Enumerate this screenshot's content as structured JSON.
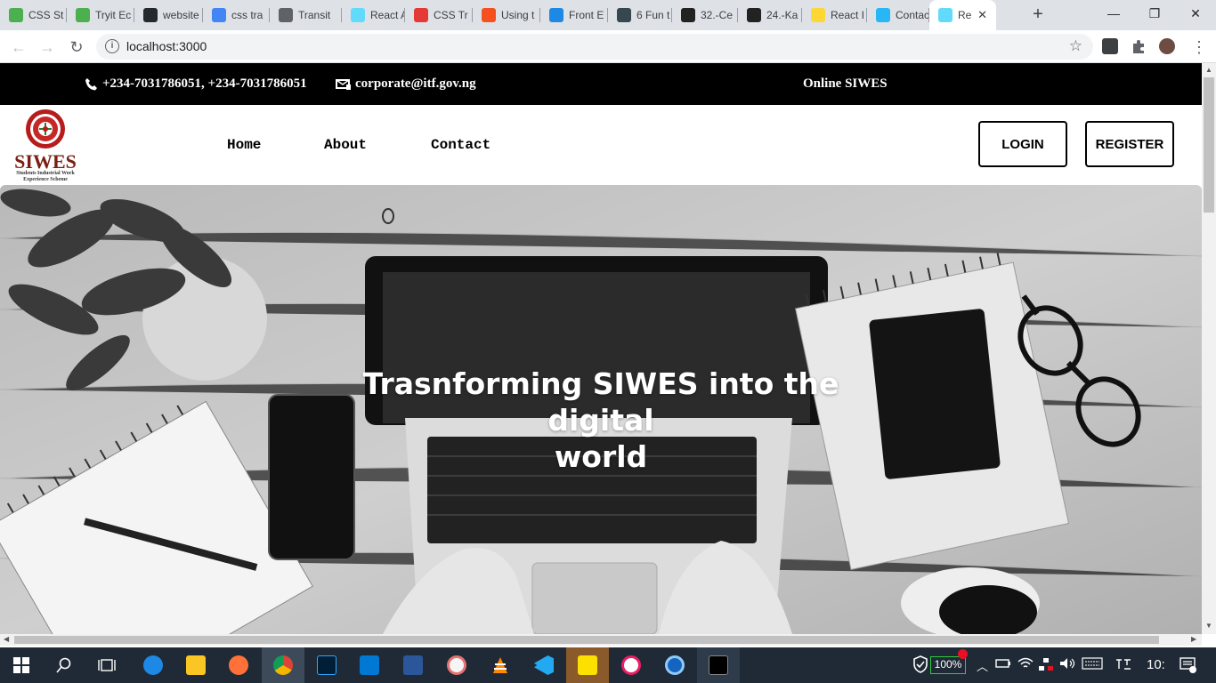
{
  "browser": {
    "tabs": [
      {
        "label": "CSS St",
        "icon": "w3schools-icon",
        "color": "#4caf50"
      },
      {
        "label": "Tryit Ec",
        "icon": "w3schools-icon",
        "color": "#4caf50"
      },
      {
        "label": "website",
        "icon": "github-icon",
        "color": "#24292e"
      },
      {
        "label": "css tra",
        "icon": "google-icon",
        "color": "#4285f4"
      },
      {
        "label": "Transit",
        "icon": "code-icon",
        "color": "#5f6368"
      },
      {
        "label": "React A",
        "icon": "react-icon",
        "color": "#61dafb"
      },
      {
        "label": "CSS Tr",
        "icon": "youtube-icon",
        "color": "#e53935"
      },
      {
        "label": "Using t",
        "icon": "asterisk-icon",
        "color": "#f4511e"
      },
      {
        "label": "Front E",
        "icon": "freecodecamp-icon",
        "color": "#1e88e5"
      },
      {
        "label": "6 Fun t",
        "icon": "dev-icon",
        "color": "#37474f"
      },
      {
        "label": "32.-Ce",
        "icon": "soundcloud-icon",
        "color": "#222222"
      },
      {
        "label": "24.-Ka",
        "icon": "soundcloud-icon",
        "color": "#222222"
      },
      {
        "label": "React I",
        "icon": "pencil-icon",
        "color": "#fdd835"
      },
      {
        "label": "Contac",
        "icon": "j-icon",
        "color": "#29b6f6"
      },
      {
        "label": "Re",
        "icon": "react-icon",
        "color": "#61dafb",
        "active": true
      }
    ],
    "new_tab": "+",
    "controls": {
      "minimize": "—",
      "maximize": "❐",
      "close": "✕"
    },
    "url": "localhost:3000",
    "back": "←",
    "forward": "→",
    "reload": "↻",
    "star": "☆"
  },
  "site": {
    "topbar": {
      "phone": "+234-7031786051, +234-7031786051",
      "email": "corporate@itf.gov.ng",
      "online": "Online SIWES"
    },
    "logo": {
      "name": "SIWES",
      "tagline_1": "Students Industrial Work",
      "tagline_2": "Experience Scheme"
    },
    "nav": {
      "home": "Home",
      "about": "About",
      "contact": "Contact"
    },
    "login": "LOGIN",
    "register": "REGISTER",
    "hero_title_1": "Trasnforming SIWES into the digital",
    "hero_title_2": "world"
  },
  "taskbar": {
    "battery": "100%"
  }
}
